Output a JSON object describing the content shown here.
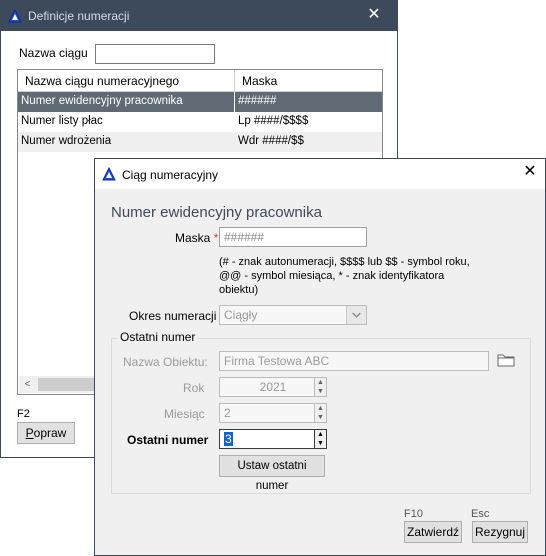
{
  "back_window": {
    "title": "Definicje numeracji",
    "name_label": "Nazwa ciągu",
    "name_value": "",
    "columns": [
      "Nazwa ciągu numeracyjnego",
      "Maska"
    ],
    "rows": [
      {
        "name": "Numer ewidencyjny pracownika",
        "mask": "######"
      },
      {
        "name": "Numer listy płac",
        "mask": "Lp ####/$$$$"
      },
      {
        "name": "Numer wdrożenia",
        "mask": "Wdr ####/$$"
      }
    ],
    "scroll_left": "<",
    "shortcut": "F2",
    "edit_button": "Popraw",
    "edit_button_rest": "opraw",
    "edit_button_mnemonic": "P"
  },
  "dialog": {
    "title": "Ciąg numeracyjny",
    "heading": "Numer ewidencyjny pracownika",
    "mask_label": "Maska",
    "required_mark": "*",
    "mask_value": "######",
    "hint_line1": "(# - znak autonumeracji, $$$$ lub $$ - symbol roku,",
    "hint_line2": "@@ - symbol miesiąca, * - znak identyfikatora",
    "hint_line3": "obiektu)",
    "period_label": "Okres numeracji",
    "period_value": "Ciągły",
    "group_title": "Ostatni numer",
    "object_label": "Nazwa Obiektu:",
    "object_value": "Firma Testowa ABC",
    "year_label": "Rok",
    "year_value": "2021",
    "month_label": "Miesiąc",
    "month_value": "2",
    "last_number_label": "Ostatni numer",
    "last_number_value": "3",
    "set_last_button": "Ustaw ostatni numer",
    "ok_shortcut": "F10",
    "ok_button": "Zatwierdź",
    "cancel_shortcut": "Esc",
    "cancel_button": "Rezygnuj"
  },
  "icons": {
    "app": "app-triangle-icon",
    "close": "close-icon",
    "folder": "folder-icon",
    "dropdown": "chevron-down-icon"
  },
  "colors": {
    "titlebar_inactive": "#3c4a5c",
    "selected_row": "#606a74",
    "required": "#d04040",
    "heading": "#3c4a5c",
    "focus_selection": "#0a64d6"
  }
}
